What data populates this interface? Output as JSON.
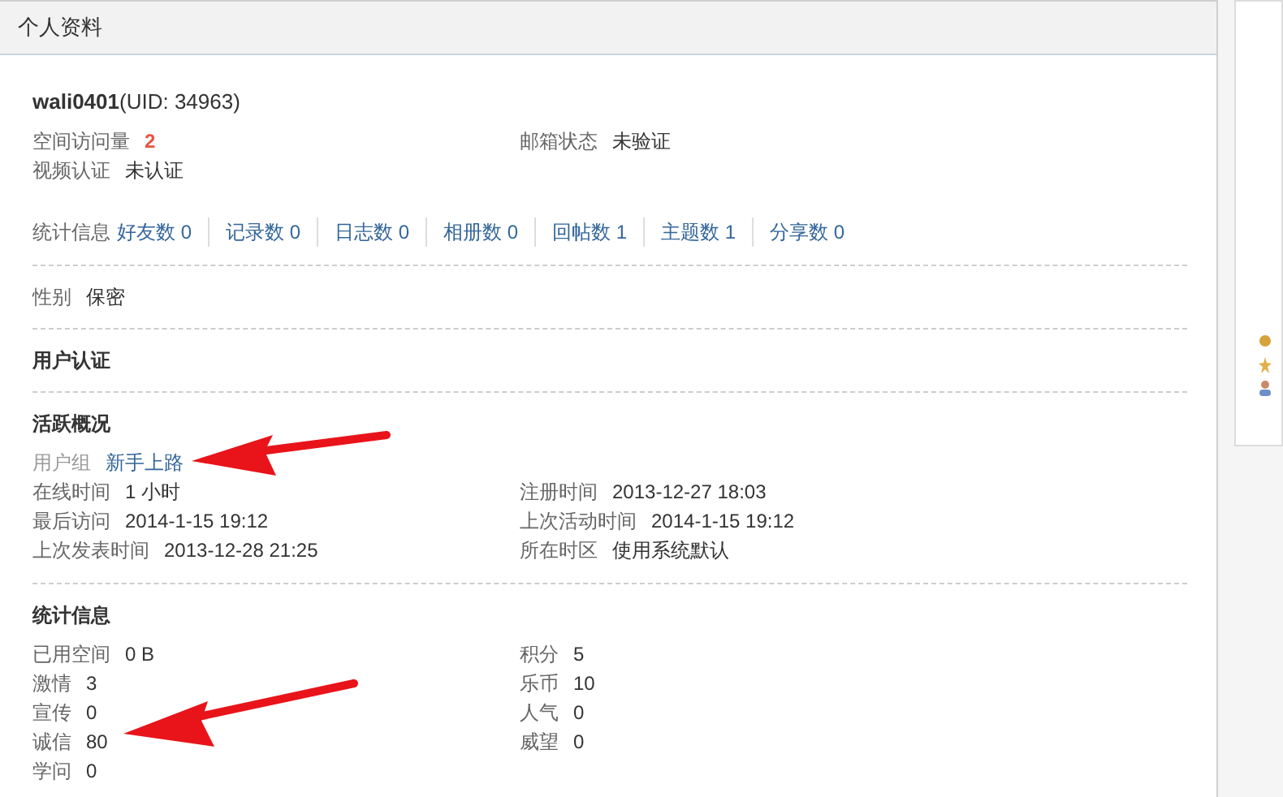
{
  "panel_title": "个人资料",
  "username": "wali0401",
  "uid": "(UID: 34963)",
  "basic_rows": [
    {
      "cells": [
        {
          "label": "空间访问量",
          "value": "2",
          "kind": "count"
        },
        {
          "label": "邮箱状态",
          "value": "未验证",
          "kind": "text"
        }
      ]
    },
    {
      "cells": [
        {
          "label": "视频认证",
          "value": "未认证",
          "kind": "text"
        }
      ]
    }
  ],
  "stats_bar": {
    "label": "统计信息",
    "links": [
      "好友数 0",
      "记录数 0",
      "日志数 0",
      "相册数 0",
      "回帖数 1",
      "主题数 1",
      "分享数 0"
    ]
  },
  "gender": {
    "label": "性别",
    "value": "保密"
  },
  "sections": [
    {
      "title": "用户认证"
    },
    {
      "title": "活跃概况",
      "rows": [
        {
          "cells": [
            {
              "label": "用户组",
              "value": "新手上路",
              "kind": "group"
            }
          ]
        },
        {
          "cells": [
            {
              "label": "在线时间",
              "value": "1 小时",
              "kind": "text"
            },
            {
              "label": "注册时间",
              "value": "2013-12-27 18:03",
              "kind": "text"
            }
          ]
        },
        {
          "cells": [
            {
              "label": "最后访问",
              "value": "2014-1-15 19:12",
              "kind": "text"
            },
            {
              "label": "上次活动时间",
              "value": "2014-1-15 19:12",
              "kind": "text"
            }
          ]
        },
        {
          "cells": [
            {
              "label": "上次发表时间",
              "value": "2013-12-28 21:25",
              "kind": "text"
            },
            {
              "label": "所在时区",
              "value": "使用系统默认",
              "kind": "text"
            }
          ]
        }
      ]
    },
    {
      "title": "统计信息",
      "rows": [
        {
          "cells": [
            {
              "label": "已用空间",
              "value": "0 B",
              "kind": "text"
            },
            {
              "label": "积分",
              "value": "5",
              "kind": "text"
            }
          ]
        },
        {
          "cells": [
            {
              "label": "激情",
              "value": "3",
              "kind": "text"
            },
            {
              "label": "乐币",
              "value": "10",
              "kind": "text"
            }
          ]
        },
        {
          "cells": [
            {
              "label": "宣传",
              "value": "0",
              "kind": "text"
            },
            {
              "label": "人气",
              "value": "0",
              "kind": "text"
            }
          ]
        },
        {
          "cells": [
            {
              "label": "诚信",
              "value": "80",
              "kind": "text"
            },
            {
              "label": "威望",
              "value": "0",
              "kind": "text"
            }
          ]
        },
        {
          "cells": [
            {
              "label": "学问",
              "value": "0",
              "kind": "text"
            }
          ]
        }
      ]
    }
  ]
}
